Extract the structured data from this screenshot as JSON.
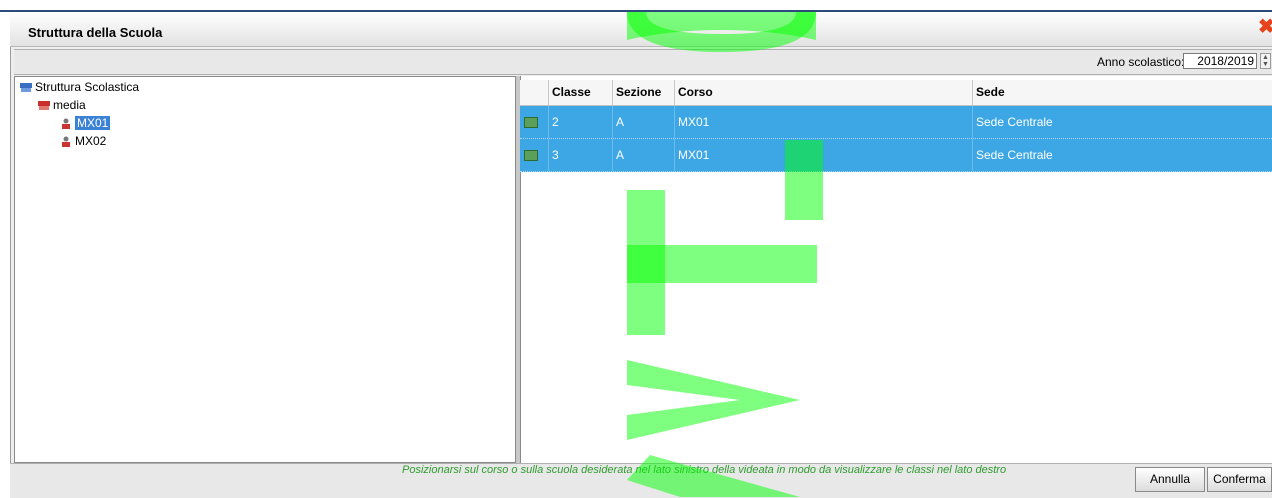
{
  "window": {
    "title": "Struttura della Scuola",
    "close_glyph": "✖"
  },
  "toolbar": {
    "year_label": "Anno scolastico:",
    "year_value": "2018/2019"
  },
  "tree": {
    "root": "Struttura Scolastica",
    "school": "media",
    "courses": [
      "MX01",
      "MX02"
    ],
    "selected": "MX01"
  },
  "grid": {
    "columns": [
      "Classe",
      "Sezione",
      "Corso",
      "Sede"
    ],
    "rows": [
      {
        "classe": "2",
        "sezione": "A",
        "corso": "MX01",
        "sede": "Sede Centrale"
      },
      {
        "classe": "3",
        "sezione": "A",
        "corso": "MX01",
        "sede": "Sede Centrale"
      }
    ]
  },
  "footer": {
    "hint": "Posizionarsi sul corso o sulla scuola desiderata nel lato sinistro della videata in modo da visualizzare le classi nel lato destro",
    "cancel_label": "Annulla",
    "confirm_label": "Conferma"
  },
  "colors": {
    "selection": "#3da7e6",
    "hint_text": "#2e9c2e",
    "close_icon": "#e8411d",
    "watermark": "#00ff00"
  },
  "watermark": {
    "text": "Dwft wm"
  }
}
